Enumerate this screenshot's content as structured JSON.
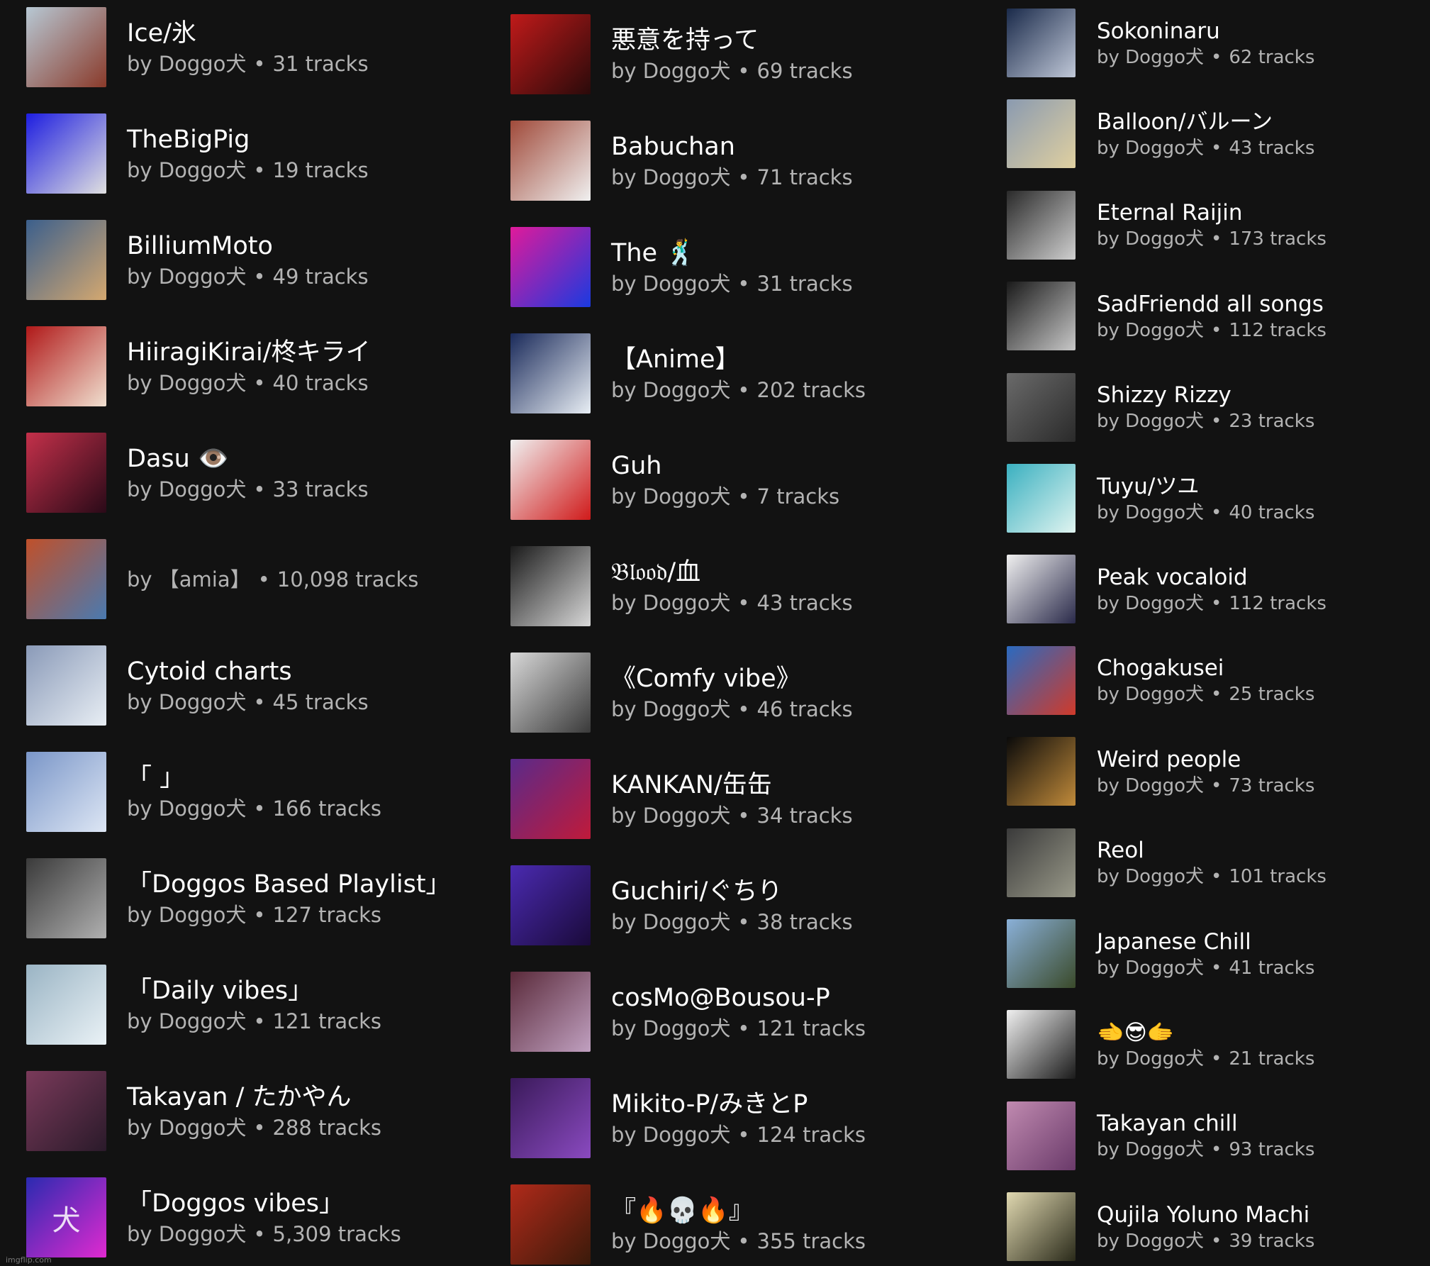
{
  "columns": [
    [
      {
        "title": "Ice/氷",
        "by": "by Doggo犬",
        "tracks": "31 tracks",
        "icon": "playlist-cover",
        "colors": [
          "#b7c8d4",
          "#8a3a2a"
        ]
      },
      {
        "title": "TheBigPig",
        "by": "by Doggo犬",
        "tracks": "19 tracks",
        "icon": "playlist-cover",
        "colors": [
          "#1d1de0",
          "#e0e0e0"
        ]
      },
      {
        "title": "BilliumMoto",
        "by": "by Doggo犬",
        "tracks": "49 tracks",
        "icon": "playlist-cover",
        "colors": [
          "#3b5f8c",
          "#d4a870"
        ]
      },
      {
        "title": "HiiragiKirai/柊キライ",
        "by": "by Doggo犬",
        "tracks": "40 tracks",
        "icon": "playlist-cover",
        "colors": [
          "#b01818",
          "#f0e0d0"
        ]
      },
      {
        "title": "Dasu 👁️",
        "by": "by Doggo犬",
        "tracks": "33 tracks",
        "icon": "playlist-cover",
        "colors": [
          "#c4304a",
          "#2a0a18"
        ]
      },
      {
        "title": "",
        "by": "by 【amia】",
        "tracks": "10,098 tracks",
        "icon": "playlist-cover",
        "colors": [
          "#c0502a",
          "#4a7ab0"
        ]
      },
      {
        "title": "Cytoid charts",
        "by": "by Doggo犬",
        "tracks": "45 tracks",
        "icon": "playlist-cover",
        "colors": [
          "#8a9ab8",
          "#e8eef4"
        ]
      },
      {
        "title": "「                    」",
        "by": "by Doggo犬",
        "tracks": "166 tracks",
        "icon": "playlist-cover",
        "colors": [
          "#7a96c8",
          "#dde6f4"
        ]
      },
      {
        "title": "「Doggos Based Playlist」",
        "by": "by Doggo犬",
        "tracks": "127 tracks",
        "icon": "playlist-cover",
        "colors": [
          "#3a3a3a",
          "#b0b0b0"
        ]
      },
      {
        "title": "「Daily vibes」",
        "by": "by Doggo犬",
        "tracks": "121 tracks",
        "icon": "playlist-cover",
        "colors": [
          "#9ab4c4",
          "#eaf2f6"
        ]
      },
      {
        "title": "Takayan / たかやん",
        "by": "by Doggo犬",
        "tracks": "288 tracks",
        "icon": "playlist-cover",
        "colors": [
          "#7a3a5a",
          "#2a1a2a"
        ]
      },
      {
        "title": "「Doggos vibes」",
        "by": "by Doggo犬",
        "tracks": "5,309 tracks",
        "icon": "playlist-cover",
        "colors": [
          "#2a2ab0",
          "#e02ad0"
        ],
        "glyph": "犬"
      }
    ],
    [
      {
        "title": "悪意を持って",
        "by": "by Doggo犬",
        "tracks": "69 tracks",
        "icon": "playlist-cover",
        "colors": [
          "#c01a1a",
          "#2a0a0a"
        ]
      },
      {
        "title": "Babuchan",
        "by": "by Doggo犬",
        "tracks": "71 tracks",
        "icon": "playlist-cover",
        "colors": [
          "#a04a3a",
          "#f0f0f0"
        ]
      },
      {
        "title": "The 🕺",
        "by": "by Doggo犬",
        "tracks": "31 tracks",
        "icon": "playlist-cover",
        "colors": [
          "#e01a9a",
          "#1a3ae0"
        ]
      },
      {
        "title": "【Anime】",
        "by": "by Doggo犬",
        "tracks": "202 tracks",
        "icon": "playlist-cover",
        "colors": [
          "#1a2a5a",
          "#e8eef4"
        ]
      },
      {
        "title": "Guh",
        "by": "by Doggo犬",
        "tracks": "7 tracks",
        "icon": "playlist-cover",
        "colors": [
          "#f0f0f0",
          "#d01a1a"
        ]
      },
      {
        "title": "𝔅𝔩𝔬𝔬𝔡/血",
        "by": "by Doggo犬",
        "tracks": "43 tracks",
        "icon": "playlist-cover",
        "colors": [
          "#1a1a1a",
          "#d8d8d8"
        ]
      },
      {
        "title": "《Comfy vibe》",
        "by": "by Doggo犬",
        "tracks": "46 tracks",
        "icon": "playlist-cover",
        "colors": [
          "#d8d8d8",
          "#3a3a3a"
        ]
      },
      {
        "title": "KANKAN/缶缶",
        "by": "by Doggo犬",
        "tracks": "34 tracks",
        "icon": "playlist-cover",
        "colors": [
          "#5a2a8a",
          "#c01a3a"
        ]
      },
      {
        "title": "Guchiri/ぐちり",
        "by": "by Doggo犬",
        "tracks": "38 tracks",
        "icon": "playlist-cover",
        "colors": [
          "#4a2ab0",
          "#1a0a3a"
        ]
      },
      {
        "title": "cosMo@Bousou-P",
        "by": "by Doggo犬",
        "tracks": "121 tracks",
        "icon": "playlist-cover",
        "colors": [
          "#5a2a3a",
          "#c0a0c0"
        ]
      },
      {
        "title": "Mikito-P/みきとP",
        "by": "by Doggo犬",
        "tracks": "124 tracks",
        "icon": "playlist-cover",
        "colors": [
          "#3a1a5a",
          "#8a4ac0"
        ]
      },
      {
        "title": "『🔥💀🔥』",
        "by": "by Doggo犬",
        "tracks": "355 tracks",
        "icon": "playlist-cover",
        "colors": [
          "#b02a1a",
          "#3a1a0a"
        ]
      }
    ],
    [
      {
        "title": "Sokoninaru",
        "by": "by Doggo犬",
        "tracks": "62 tracks",
        "icon": "playlist-cover",
        "colors": [
          "#1a2a4a",
          "#c0c8d8"
        ]
      },
      {
        "title": "Balloon/バルーン",
        "by": "by Doggo犬",
        "tracks": "43 tracks",
        "icon": "playlist-cover",
        "colors": [
          "#8a9ab0",
          "#e0d0a0"
        ]
      },
      {
        "title": "Eternal Raijin",
        "by": "by Doggo犬",
        "tracks": "173 tracks",
        "icon": "playlist-cover",
        "colors": [
          "#2a2a2a",
          "#d0d0d0"
        ]
      },
      {
        "title": "SadFriendd all songs",
        "by": "by Doggo犬",
        "tracks": "112 tracks",
        "icon": "playlist-cover",
        "colors": [
          "#1a1a1a",
          "#c8c8c8"
        ]
      },
      {
        "title": "Shizzy Rizzy",
        "by": "by Doggo犬",
        "tracks": "23 tracks",
        "icon": "playlist-cover",
        "colors": [
          "#6a6a6a",
          "#2a2a2a"
        ]
      },
      {
        "title": "Tuyu/ツユ",
        "by": "by Doggo犬",
        "tracks": "40 tracks",
        "icon": "playlist-cover",
        "colors": [
          "#3ab0c0",
          "#e0f4f0"
        ]
      },
      {
        "title": " Peak vocaloid",
        "by": "by Doggo犬",
        "tracks": "112 tracks",
        "icon": "playlist-cover",
        "colors": [
          "#f0f0f0",
          "#2a2a4a"
        ]
      },
      {
        "title": "Chogakusei",
        "by": "by Doggo犬",
        "tracks": "25 tracks",
        "icon": "playlist-cover",
        "colors": [
          "#2a6ac0",
          "#d03a2a"
        ]
      },
      {
        "title": "Weird people",
        "by": "by Doggo犬",
        "tracks": "73 tracks",
        "icon": "playlist-cover",
        "colors": [
          "#0a0a0a",
          "#c08a3a"
        ]
      },
      {
        "title": "Reol",
        "by": "by Doggo犬",
        "tracks": "101 tracks",
        "icon": "playlist-cover",
        "colors": [
          "#3a3a3a",
          "#9a9a8a"
        ]
      },
      {
        "title": "Japanese Chill",
        "by": "by Doggo犬",
        "tracks": "41 tracks",
        "icon": "playlist-cover",
        "colors": [
          "#8ab0d8",
          "#3a4a2a"
        ]
      },
      {
        "title": "🫲😎🫱",
        "by": "by Doggo犬",
        "tracks": "21 tracks",
        "icon": "playlist-cover",
        "colors": [
          "#f0f0f0",
          "#1a1a1a"
        ]
      },
      {
        "title": "Takayan chill",
        "by": "by Doggo犬",
        "tracks": "93 tracks",
        "icon": "playlist-cover",
        "colors": [
          "#c08ab0",
          "#6a3a6a"
        ]
      },
      {
        "title": "Qujila Yoluno Machi",
        "by": "by Doggo犬",
        "tracks": "39 tracks",
        "icon": "playlist-cover",
        "colors": [
          "#e0d8b0",
          "#2a2a1a"
        ]
      }
    ]
  ],
  "watermark": "imgflip.com"
}
